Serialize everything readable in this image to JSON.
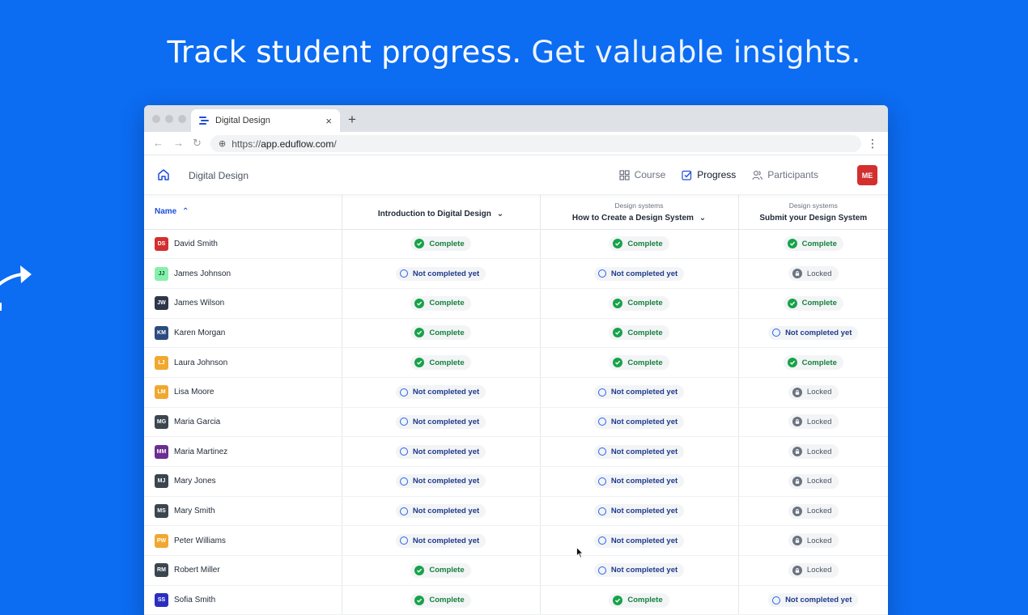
{
  "headline": {
    "strong": "Track student progress.",
    "light": "Get valuable insights."
  },
  "browser": {
    "tab_title": "Digital Design",
    "tab_close": "×",
    "new_tab": "+",
    "url_scheme": "https://",
    "url_host": "app.eduflow.com",
    "url_path": "/"
  },
  "app": {
    "course_title": "Digital Design",
    "nav": [
      {
        "label": "Course",
        "icon": "grid-icon"
      },
      {
        "label": "Progress",
        "icon": "checkbox-icon",
        "active": true
      },
      {
        "label": "Participants",
        "icon": "users-icon"
      }
    ],
    "user_initials": "ME"
  },
  "table": {
    "name_header": "Name",
    "columns": [
      {
        "sub": "",
        "title": "Introduction to Digital Design",
        "chevron": true
      },
      {
        "sub": "Design systems",
        "title": "How to Create a Design System",
        "chevron": true
      },
      {
        "sub": "Design systems",
        "title": "Submit your Design System",
        "chevron": false
      }
    ],
    "status_labels": {
      "complete": "Complete",
      "notdone": "Not completed yet",
      "locked": "Locked"
    },
    "rows": [
      {
        "initials": "DS",
        "name": "David Smith",
        "color": "#d32f2f",
        "status": [
          "complete",
          "complete",
          "complete"
        ]
      },
      {
        "initials": "JJ",
        "name": "James Johnson",
        "color": "#86efac",
        "status": [
          "notdone",
          "notdone",
          "locked"
        ]
      },
      {
        "initials": "JW",
        "name": "James Wilson",
        "color": "#2d3748",
        "status": [
          "complete",
          "complete",
          "complete"
        ]
      },
      {
        "initials": "KM",
        "name": "Karen Morgan",
        "color": "#2b4c7e",
        "status": [
          "complete",
          "complete",
          "notdone"
        ]
      },
      {
        "initials": "LJ",
        "name": "Laura Johnson",
        "color": "#f0a830",
        "status": [
          "complete",
          "complete",
          "complete"
        ]
      },
      {
        "initials": "LM",
        "name": "Lisa Moore",
        "color": "#f0a830",
        "status": [
          "notdone",
          "notdone",
          "locked"
        ]
      },
      {
        "initials": "MG",
        "name": "Maria Garcia",
        "color": "#3c4650",
        "status": [
          "notdone",
          "notdone",
          "locked"
        ]
      },
      {
        "initials": "MM",
        "name": "Maria Martinez",
        "color": "#6b2d8f",
        "status": [
          "notdone",
          "notdone",
          "locked"
        ]
      },
      {
        "initials": "MJ",
        "name": "Mary Jones",
        "color": "#3c4650",
        "status": [
          "notdone",
          "notdone",
          "locked"
        ]
      },
      {
        "initials": "MS",
        "name": "Mary Smith",
        "color": "#3c4650",
        "status": [
          "notdone",
          "notdone",
          "locked"
        ]
      },
      {
        "initials": "PW",
        "name": "Peter Williams",
        "color": "#f0a830",
        "status": [
          "notdone",
          "notdone",
          "locked"
        ]
      },
      {
        "initials": "RM",
        "name": "Robert Miller",
        "color": "#3c4650",
        "status": [
          "complete",
          "notdone",
          "locked"
        ]
      },
      {
        "initials": "SS",
        "name": "Sofia Smith",
        "color": "#2a2fbf",
        "status": [
          "complete",
          "complete",
          "notdone"
        ]
      }
    ]
  }
}
